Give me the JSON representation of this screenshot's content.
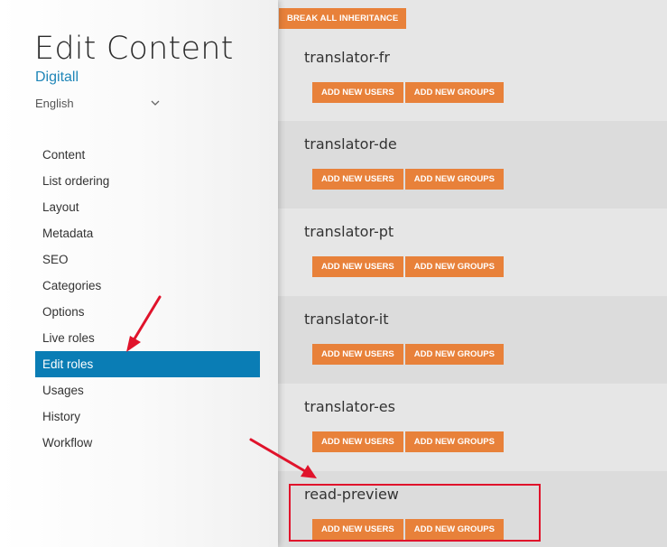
{
  "sidebar": {
    "title": "Edit Content",
    "site": "Digitall",
    "language": "English",
    "nav": [
      {
        "label": "Content"
      },
      {
        "label": "List ordering"
      },
      {
        "label": "Layout"
      },
      {
        "label": "Metadata"
      },
      {
        "label": "SEO"
      },
      {
        "label": "Categories"
      },
      {
        "label": "Options"
      },
      {
        "label": "Live roles"
      },
      {
        "label": "Edit roles",
        "active": true
      },
      {
        "label": "Usages"
      },
      {
        "label": "History"
      },
      {
        "label": "Workflow"
      }
    ]
  },
  "main": {
    "break_label": "BREAK ALL INHERITANCE",
    "add_users_label": "ADD NEW USERS",
    "add_groups_label": "ADD NEW GROUPS",
    "roles": [
      {
        "name": "translator-fr"
      },
      {
        "name": "translator-de"
      },
      {
        "name": "translator-pt"
      },
      {
        "name": "translator-it"
      },
      {
        "name": "translator-es"
      },
      {
        "name": "read-preview"
      }
    ]
  },
  "colors": {
    "accent": "#e8813a",
    "active_nav": "#0a7db5",
    "annotation": "#e0132b"
  },
  "icons": {
    "language_dropdown": "chevron-down-icon"
  }
}
